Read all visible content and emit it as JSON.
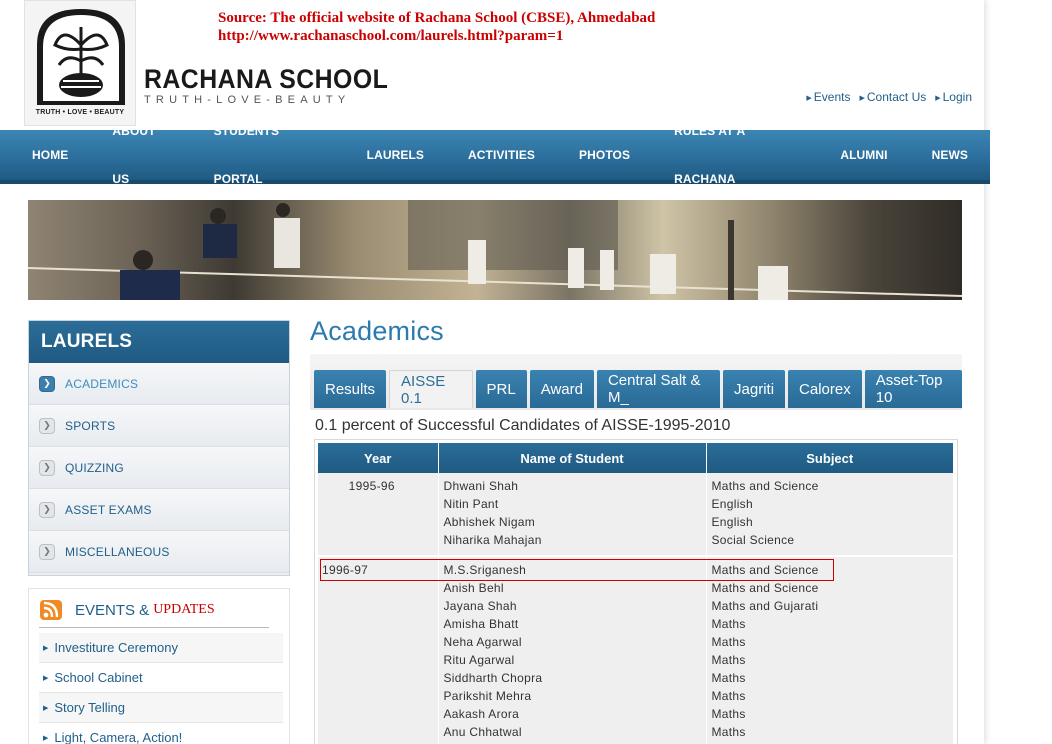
{
  "source": {
    "line1": "Source: The official website of Rachana School (CBSE), Ahmedabad",
    "line2": "http://www.rachanaschool.com/laurels.html?param=1"
  },
  "header": {
    "logo_text": "TRUTH • LOVE • BEAUTY",
    "school_name": "RACHANA SCHOOL",
    "tagline": "TRUTH-LOVE-BEAUTY",
    "top_links": [
      "Events",
      "Contact Us",
      "Login"
    ]
  },
  "nav": {
    "items": [
      "HOME",
      "ABOUT US",
      "STUDENTS' PORTAL",
      "LAURELS",
      "ACTIVITIES",
      "PHOTOS",
      "RULES AT A RACHANA",
      "ALUMNI",
      "NEWS"
    ]
  },
  "sidebar": {
    "title": "LAURELS",
    "items": [
      "ACADEMICS",
      "SPORTS",
      "QUIZZING",
      "ASSET EXAMS",
      "MISCELLANEOUS"
    ],
    "active_index": 0
  },
  "events": {
    "title": "EVENTS &",
    "title_accent": "UPDATES",
    "items": [
      "Investiture Ceremony",
      "School Cabinet",
      "Story Telling",
      "Light, Camera, Action!"
    ]
  },
  "content": {
    "title": "Academics",
    "tabs": [
      "Results",
      "AISSE 0.1",
      "PRL",
      "Award",
      "Central Salt & M_",
      "Jagriti",
      "Calorex",
      "Asset-Top 10"
    ],
    "active_tab": 1,
    "caption": "0.1 percent of Successful Candidates of AISSE-1995-2010",
    "table": {
      "headers": [
        "Year",
        "Name of Student",
        "Subject"
      ],
      "groups": [
        {
          "year": "1995-96",
          "names": [
            "Dhwani Shah",
            "Nitin Pant",
            "Abhishek Nigam",
            "Niharika Mahajan"
          ],
          "subjects": [
            "Maths and Science",
            "English",
            "English",
            "Social Science"
          ]
        },
        {
          "year": "1996-97",
          "names": [
            "M.S.Sriganesh",
            "Anish Behl",
            "Jayana Shah",
            "Amisha Bhatt",
            "Neha Agarwal",
            "Ritu Agarwal",
            "Siddharth Chopra",
            "Parikshit Mehra",
            "Aakash Arora",
            "Anu Chhatwal"
          ],
          "subjects": [
            "Maths and Science",
            "Maths and Science",
            "Maths and Gujarati",
            "Maths",
            "Maths",
            "Maths",
            "Maths",
            "Maths",
            "Maths",
            "Maths"
          ]
        }
      ]
    }
  },
  "colors": {
    "nav_blue": "#2c6f9c",
    "link_blue": "#1f5f8b",
    "source_red": "#cc0000",
    "title_blue": "#2b7ab0"
  }
}
